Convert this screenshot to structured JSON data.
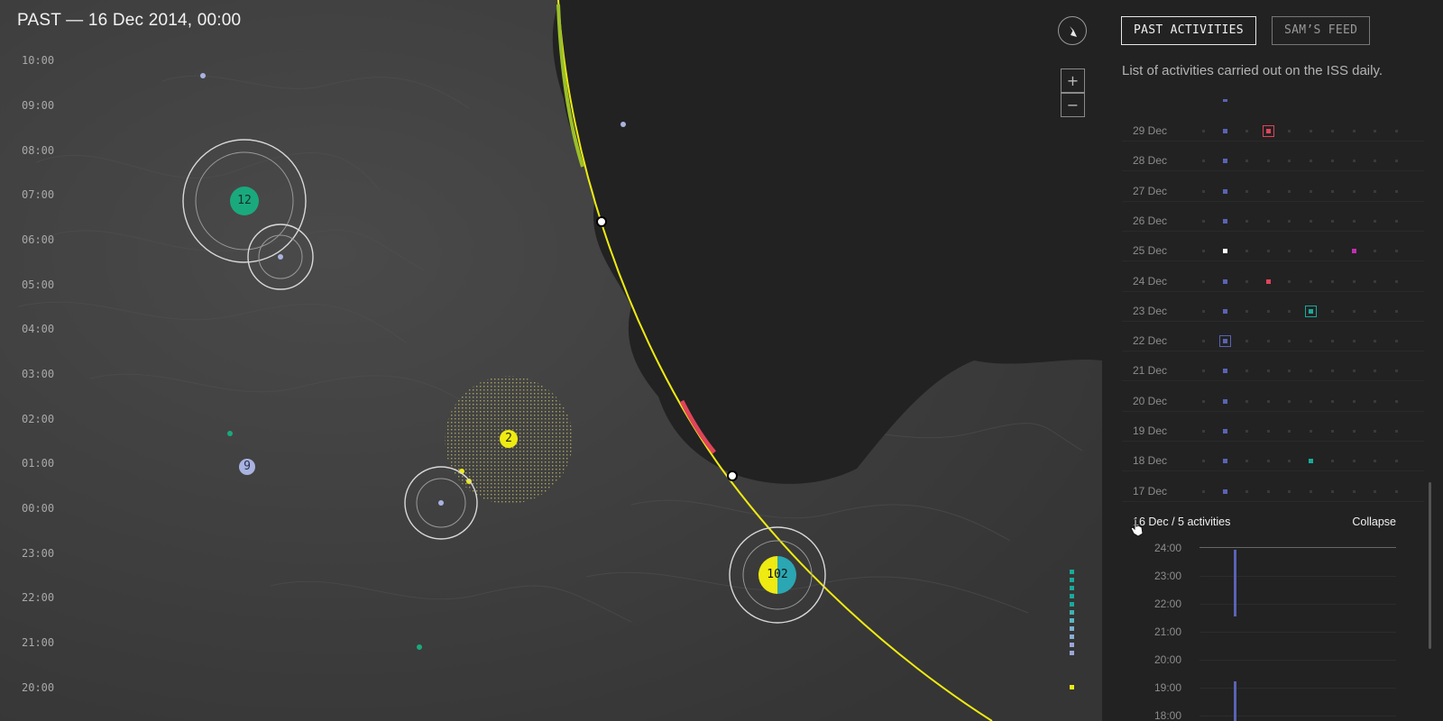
{
  "header": {
    "title": "PAST — 16 Dec 2014, 00:00"
  },
  "time_ticks": [
    "10:00",
    "09:00",
    "08:00",
    "07:00",
    "06:00",
    "05:00",
    "04:00",
    "03:00",
    "02:00",
    "01:00",
    "00:00",
    "23:00",
    "22:00",
    "21:00",
    "20:00"
  ],
  "map_controls": {
    "zoom_in": "+",
    "zoom_out": "−",
    "compass_icon": "compass-icon"
  },
  "clusters": [
    {
      "id": "cluster-12",
      "count": "12",
      "color": "#1aa97c"
    },
    {
      "id": "cluster-2",
      "count": "2",
      "color": "#eeea12"
    },
    {
      "id": "cluster-9",
      "count": "9",
      "color": "#a9b3e0"
    },
    {
      "id": "cluster-102",
      "count": "102",
      "colors": [
        "#eeea12",
        "#2aa7b2"
      ]
    }
  ],
  "colors": {
    "orbit": "#eeea12",
    "orbit_green_segment": "#9bbf2a",
    "orbit_red_segment": "#e0445a",
    "activity_blue": "#5a63b4",
    "activity_pink": "#e0445a",
    "activity_teal": "#1aa99a",
    "activity_magenta": "#c12eb3",
    "legend_teal": "#1aa99a",
    "legend_lavender": "#9aa6d8",
    "legend_yellow": "#eeea12"
  },
  "panel": {
    "tabs": [
      {
        "label": "PAST ACTIVITIES",
        "active": true
      },
      {
        "label": "SAM’S FEED",
        "active": false
      }
    ],
    "description": "List of activities carried out on the ISS daily.",
    "days": [
      "29 Dec",
      "28  Dec",
      "27 Dec",
      "26 Dec",
      "25 Dec",
      "24 Dec",
      "23 Dec",
      "22 Dec",
      "21 Dec",
      "20 Dec",
      "19 Dec",
      "18 Dec",
      "17 Dec"
    ],
    "expanded": {
      "title": "16 Dec / 5 activities",
      "collapse_label": "Collapse"
    },
    "hours": [
      "24:00",
      "23:00",
      "22:00",
      "21:00",
      "20:00",
      "19:00",
      "18:00"
    ]
  }
}
